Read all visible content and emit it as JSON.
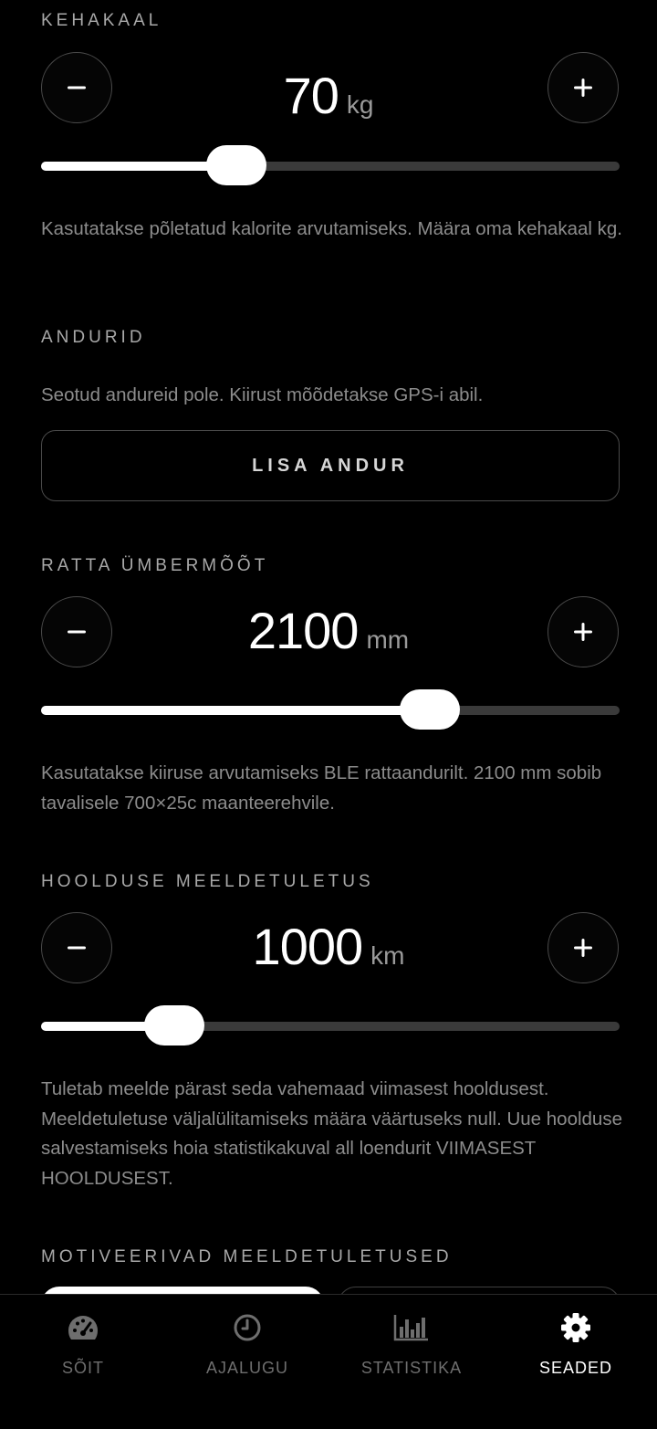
{
  "body_weight": {
    "title": "KEHAKAAL",
    "value": "70",
    "unit": "kg",
    "slider_fraction": 0.338,
    "description": "Kasutatakse põletatud kalorite arvutamiseks. Määra oma kehakaal kg."
  },
  "sensors": {
    "title": "ANDURID",
    "status_text": "Seotud andureid pole. Kiirust mõõdetakse GPS-i abil.",
    "add_button_label": "LISA ANDUR"
  },
  "wheel_circumference": {
    "title": "RATTA ÜMBERMÕÕT",
    "value": "2100",
    "unit": "mm",
    "slider_fraction": 0.672,
    "description": "Kasutatakse kiiruse arvutamiseks BLE rattaandurilt. 2100 mm sobib tavalisele 700×25c maanteerehvile."
  },
  "maintenance_reminder": {
    "title": "HOOLDUSE MEELDETULETUS",
    "value": "1000",
    "unit": "km",
    "slider_fraction": 0.23,
    "description": "Tuletab meelde pärast seda vahemaad viimasest hooldusest. Meeldetuletuse väljalülitamiseks määra väärtuseks null. Uue hoolduse salvestamiseks hoia statistikakuval all loendurit VIIMASEST HOOLDUSEST."
  },
  "motivational_reminders": {
    "title": "MOTIVEERIVAD MEELDETULETUSED"
  },
  "nav": {
    "ride": "SÕIT",
    "history": "AJALUGU",
    "statistics": "STATISTIKA",
    "settings": "SEADED",
    "active": "settings"
  },
  "colors": {
    "background": "#000000",
    "accent": "#ffffff",
    "muted_text": "#8c8c8c",
    "track": "#3a3a3a"
  }
}
